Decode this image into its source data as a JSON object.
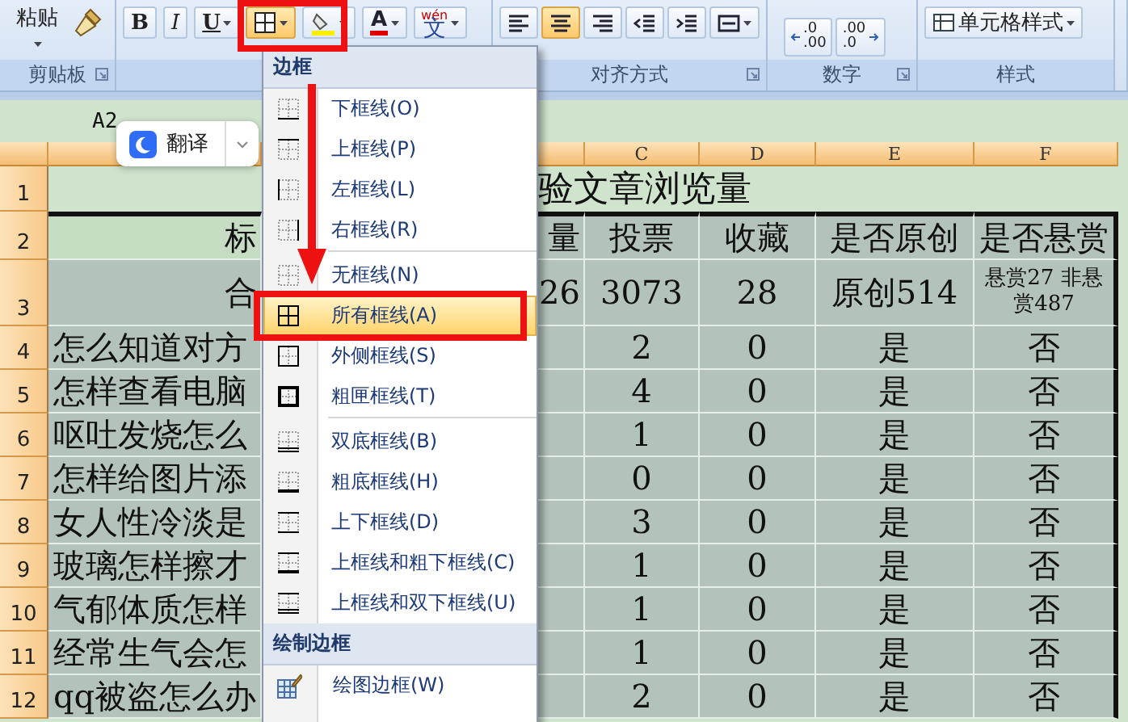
{
  "ribbon": {
    "clipboard": {
      "paste_label": "粘贴",
      "label": "剪贴板"
    },
    "font": {
      "buttons": [
        {
          "kind": "bold",
          "text": "B",
          "dropdown": false
        },
        {
          "kind": "italic",
          "text": "I",
          "dropdown": false
        },
        {
          "kind": "underline",
          "text": "U",
          "dropdown": true
        },
        {
          "kind": "borders",
          "dropdown": true
        },
        {
          "kind": "fill_color",
          "dropdown": true
        },
        {
          "kind": "font_color",
          "text": "A",
          "dropdown": true
        },
        {
          "kind": "phonetic",
          "text": "文",
          "ruby": "wén",
          "dropdown": true
        }
      ]
    },
    "alignment": {
      "label": "对齐方式",
      "buttons": [
        {
          "kind": "align_left",
          "selected": false
        },
        {
          "kind": "align_center",
          "selected": true
        },
        {
          "kind": "align_right",
          "selected": false
        },
        {
          "kind": "indent_decrease",
          "selected": false
        },
        {
          "kind": "indent_increase",
          "selected": false
        },
        {
          "kind": "merge",
          "selected": false
        }
      ]
    },
    "number": {
      "label": "数字",
      "buttons": [
        {
          "kind": "increase_decimal",
          "lines": [
            ".0",
            ".00"
          ]
        },
        {
          "kind": "decrease_decimal",
          "lines": [
            ".00",
            ".0"
          ]
        }
      ]
    },
    "styles": {
      "label": "样式",
      "button": "单元格样式"
    }
  },
  "formula_bar": {
    "name_box": "A2"
  },
  "translate_popup": {
    "label": "翻译"
  },
  "sheet": {
    "columns": [
      "C",
      "D",
      "E",
      "F"
    ],
    "title_row": {
      "number": "1",
      "title": "验文章浏览量"
    },
    "rows": [
      {
        "kind": "header",
        "number": "2",
        "a": "标",
        "b": "量",
        "c": "投票",
        "d": "收藏",
        "e": "是否原创",
        "f": "是否悬赏"
      },
      {
        "kind": "total",
        "number": "3",
        "a": "合",
        "b": "26",
        "c": "3073",
        "d": "28",
        "e": "原创514",
        "f": "悬赏27 非悬赏487"
      },
      {
        "kind": "data",
        "number": "4",
        "a": "怎么知道对方",
        "c": "2",
        "d": "0",
        "e": "是",
        "f": "否"
      },
      {
        "kind": "data",
        "number": "5",
        "a": "怎样查看电脑",
        "c": "4",
        "d": "0",
        "e": "是",
        "f": "否"
      },
      {
        "kind": "data",
        "number": "6",
        "a": "呕吐发烧怎么",
        "c": "1",
        "d": "0",
        "e": "是",
        "f": "否"
      },
      {
        "kind": "data",
        "number": "7",
        "a": "怎样给图片添",
        "c": "0",
        "d": "0",
        "e": "是",
        "f": "否"
      },
      {
        "kind": "data",
        "number": "8",
        "a": "女人性冷淡是",
        "c": "3",
        "d": "0",
        "e": "是",
        "f": "否"
      },
      {
        "kind": "data",
        "number": "9",
        "a": "玻璃怎样擦才",
        "c": "1",
        "d": "0",
        "e": "是",
        "f": "否"
      },
      {
        "kind": "data",
        "number": "10",
        "a": "气郁体质怎样",
        "c": "1",
        "d": "0",
        "e": "是",
        "f": "否"
      },
      {
        "kind": "data",
        "number": "11",
        "a": "经常生气会怎",
        "c": "1",
        "d": "0",
        "e": "是",
        "f": "否"
      },
      {
        "kind": "data",
        "number": "12",
        "a": "qq被盗怎么办",
        "c": "2",
        "d": "0",
        "e": "是",
        "f": "否"
      }
    ]
  },
  "border_menu": {
    "title": "边框",
    "items": [
      {
        "kind": "bottom",
        "label": "下框线(O)",
        "selected": false
      },
      {
        "kind": "top",
        "label": "上框线(P)",
        "selected": false
      },
      {
        "kind": "left",
        "label": "左框线(L)",
        "selected": false
      },
      {
        "kind": "right",
        "label": "右框线(R)",
        "selected": false
      },
      {
        "kind": "separator"
      },
      {
        "kind": "none",
        "label": "无框线(N)",
        "selected": false
      },
      {
        "kind": "all",
        "label": "所有框线(A)",
        "selected": true
      },
      {
        "kind": "outside",
        "label": "外侧框线(S)",
        "selected": false
      },
      {
        "kind": "thick_box",
        "label": "粗匣框线(T)",
        "selected": false
      },
      {
        "kind": "separator"
      },
      {
        "kind": "double_bottom",
        "label": "双底框线(B)",
        "selected": false
      },
      {
        "kind": "thick_bottom",
        "label": "粗底框线(H)",
        "selected": false
      },
      {
        "kind": "top_bottom",
        "label": "上下框线(D)",
        "selected": false
      },
      {
        "kind": "top_thick_bottom",
        "label": "上框线和粗下框线(C)",
        "selected": false
      },
      {
        "kind": "top_double_bottom",
        "label": "上框线和双下框线(U)",
        "selected": false
      }
    ],
    "section_title": "绘制边框",
    "draw_items": [
      {
        "kind": "draw_border",
        "label": "绘图边框(W)"
      }
    ]
  },
  "annotations": [
    {
      "kind": "button_box"
    },
    {
      "kind": "item_box"
    },
    {
      "kind": "arrow"
    }
  ]
}
